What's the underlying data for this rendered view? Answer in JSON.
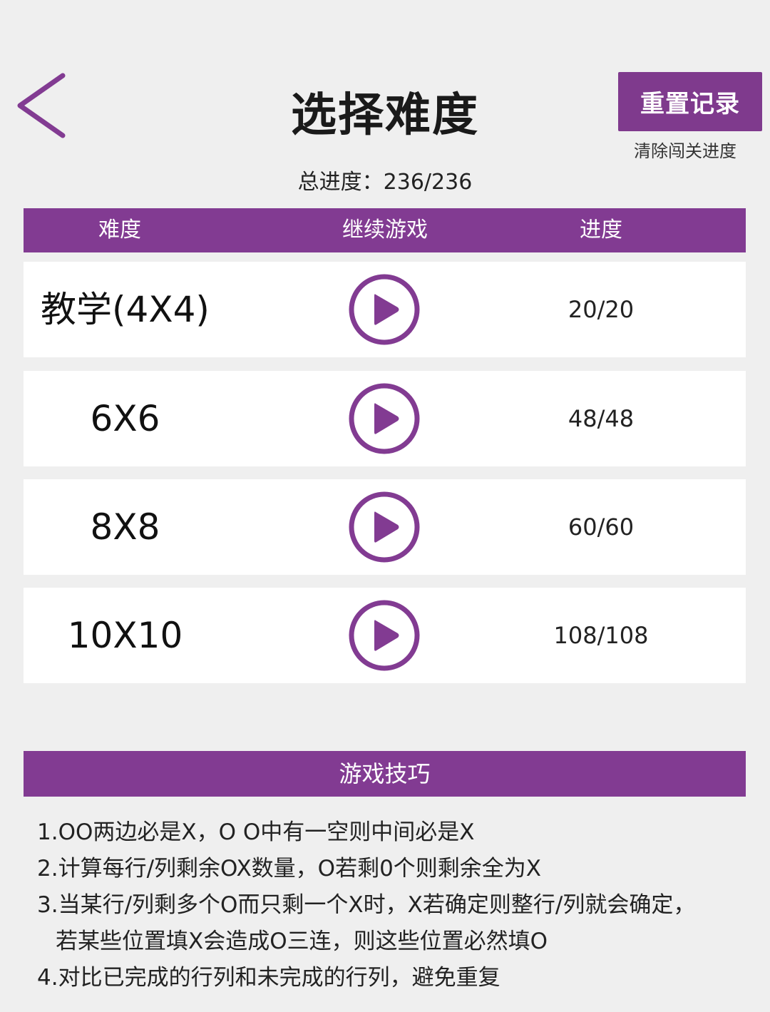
{
  "header": {
    "title": "选择难度",
    "reset_label": "重置记录",
    "reset_hint": "清除闯关进度",
    "total_progress": "总进度：236/236"
  },
  "table": {
    "headers": [
      "难度",
      "继续游戏",
      "进度"
    ],
    "rows": [
      {
        "name": "教学(4X4)",
        "progress": "20/20"
      },
      {
        "name": "6X6",
        "progress": "48/48"
      },
      {
        "name": "8X8",
        "progress": "60/60"
      },
      {
        "name": "10X10",
        "progress": "108/108"
      }
    ]
  },
  "tips": {
    "title": "游戏技巧",
    "lines": [
      "1.OO两边必是X，O O中有一空则中间必是X",
      "2.计算每行/列剩余OX数量，O若剩0个则剩余全为X",
      "3.当某行/列剩多个O而只剩一个X时，X若确定则整行/列就会确定，",
      "若某些位置填X会造成O三连，则这些位置必然填O",
      "4.对比已完成的行列和未完成的行列，避免重复"
    ]
  },
  "colors": {
    "accent": "#823b92",
    "background": "#efefef",
    "row_background": "#ffffff"
  },
  "icons": {
    "back": "chevron-left-icon",
    "play": "play-circle-icon"
  }
}
